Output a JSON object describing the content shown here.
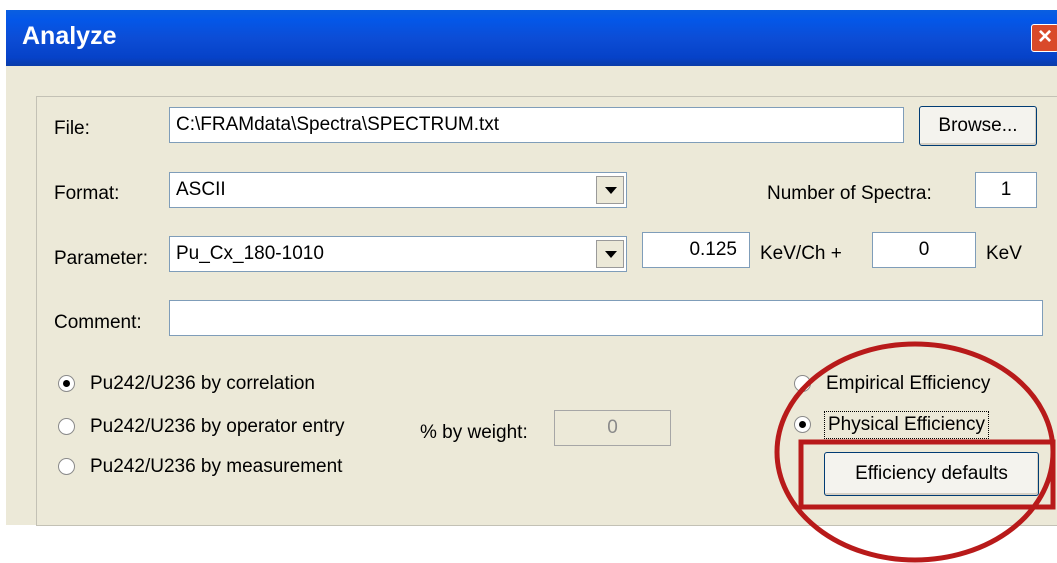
{
  "window": {
    "title": "Analyze",
    "close_symbol": "×"
  },
  "file": {
    "label": "File:",
    "value": "C:\\FRAMdata\\Spectra\\SPECTRUM.txt",
    "browse_label": "Browse..."
  },
  "format": {
    "label": "Format:",
    "value": "ASCII",
    "num_spectra_label": "Number of Spectra:",
    "num_spectra_value": "1"
  },
  "parameter": {
    "label": "Parameter:",
    "value": "Pu_Cx_180-1010",
    "gain_value": "0.125",
    "gain_unit": "KeV/Ch +",
    "offset_value": "0",
    "offset_unit": "KeV"
  },
  "comment": {
    "label": "Comment:",
    "value": ""
  },
  "pu242_options": [
    {
      "label": "Pu242/U236 by correlation",
      "selected": true
    },
    {
      "label": "Pu242/U236 by operator entry",
      "selected": false
    },
    {
      "label": "Pu242/U236 by measurement",
      "selected": false
    }
  ],
  "weight": {
    "label": "% by weight:",
    "value": "0"
  },
  "efficiency_options": [
    {
      "label": "Empirical Efficiency",
      "selected": false
    },
    {
      "label": "Physical Efficiency",
      "selected": true
    }
  ],
  "efficiency_defaults_label": "Efficiency defaults",
  "annotation_color": "#b81a1a",
  "icons": {
    "close": "close-icon",
    "dropdown": "chevron-down-icon"
  }
}
